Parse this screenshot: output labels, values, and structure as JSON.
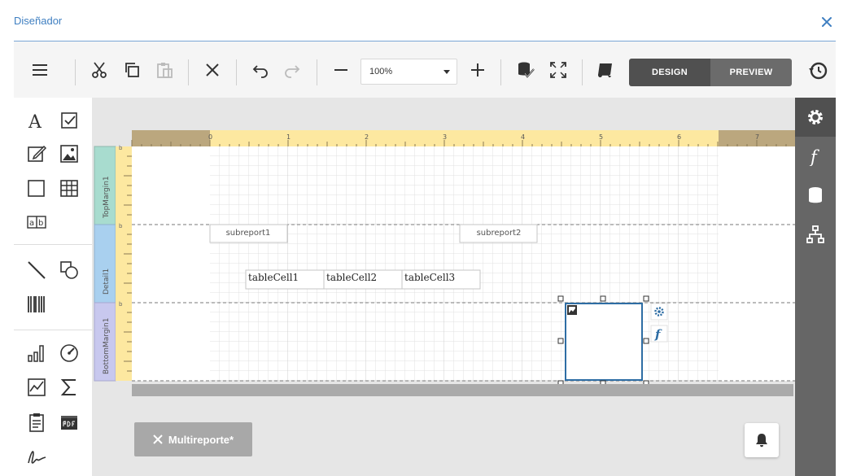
{
  "dialog": {
    "title": "Diseñador"
  },
  "toolbar": {
    "zoom_value": "100%",
    "design_label": "DESIGN",
    "preview_label": "PREVIEW"
  },
  "ruler": {
    "ticks": [
      "0",
      "1",
      "2",
      "3",
      "4",
      "5",
      "6",
      "7"
    ]
  },
  "bands": {
    "top_margin": "TopMargin1",
    "detail": "Detail1",
    "bottom_margin": "BottomMargin1",
    "band_marker": "b"
  },
  "controls": {
    "subreport1": "subreport1",
    "subreport2": "subreport2",
    "cells": [
      "tableCell1",
      "tableCell2",
      "tableCell3"
    ]
  },
  "bottom": {
    "tab_label": "Multireporte*"
  },
  "colors": {
    "accent": "#3f7fc1",
    "selection": "#2e6da4",
    "ruler": "#fde8a0",
    "ruler_dark": "#bba77e",
    "band_top": "#a8dccf",
    "band_detail": "#a9d0ef",
    "band_bottom": "#c8c8ee"
  }
}
